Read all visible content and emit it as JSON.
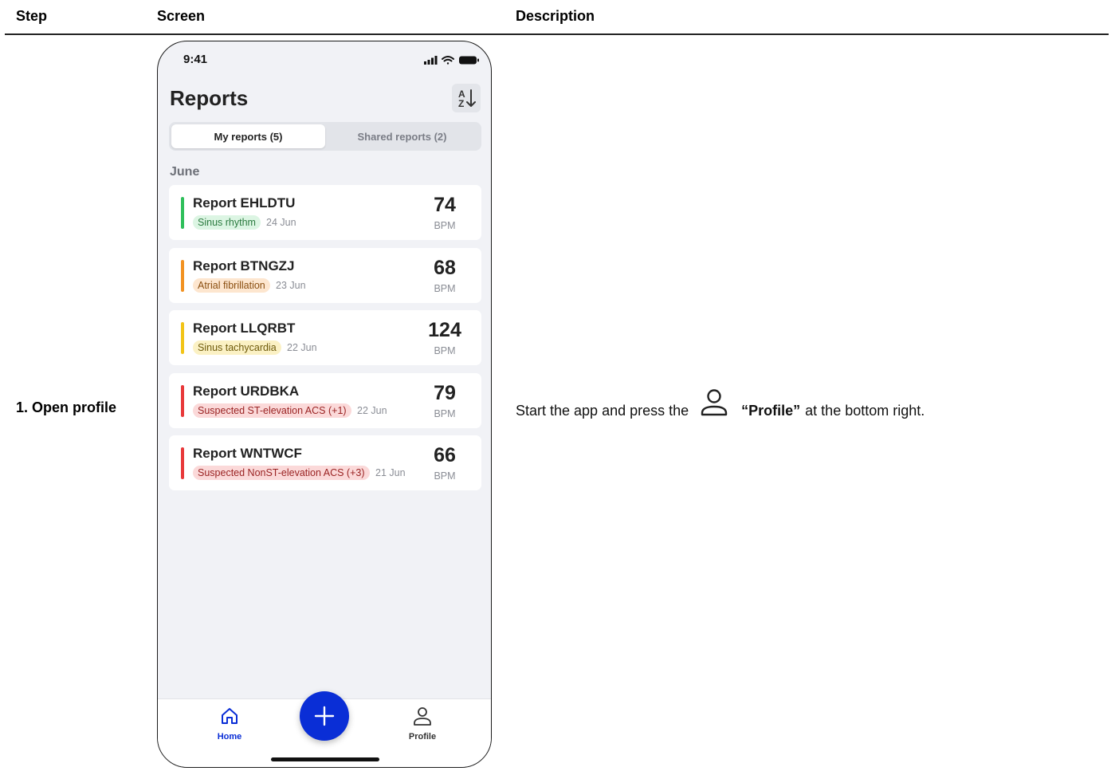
{
  "table": {
    "headers": {
      "step": "Step",
      "screen": "Screen",
      "description": "Description"
    },
    "step_label": "1. Open profile",
    "description": {
      "prefix": "Start the app and press the",
      "icon": "person-icon",
      "bold": "“Profile”",
      "suffix": "at the bottom right."
    }
  },
  "phone": {
    "status": {
      "time": "9:41",
      "icons": [
        "signal-icon",
        "wifi-icon",
        "battery-icon"
      ]
    },
    "title": "Reports",
    "sort_icon": "sort-az-icon",
    "tabs": {
      "my": "My reports (5)",
      "shared": "Shared reports (2)"
    },
    "month": "June",
    "reports": [
      {
        "name": "Report EHLDTU",
        "tag": "Sinus rhythm",
        "date": "24 Jun",
        "bpm": "74",
        "unit": "BPM",
        "color": "#2fbf5b",
        "tag_bg": "#dcf5e3",
        "tag_fg": "#2b7a3f"
      },
      {
        "name": "Report BTNGZJ",
        "tag": "Atrial fibrillation",
        "date": "23 Jun",
        "bpm": "68",
        "unit": "BPM",
        "color": "#f29222",
        "tag_bg": "#fde6cf",
        "tag_fg": "#8a4e10"
      },
      {
        "name": "Report LLQRBT",
        "tag": "Sinus tachycardia",
        "date": "22 Jun",
        "bpm": "124",
        "unit": "BPM",
        "color": "#f2c418",
        "tag_bg": "#fbf1c4",
        "tag_fg": "#6e5a0a"
      },
      {
        "name": "Report URDBKA",
        "tag": "Suspected ST-elevation ACS (+1)",
        "date": "22 Jun",
        "bpm": "79",
        "unit": "BPM",
        "color": "#e8393a",
        "tag_bg": "#fbd9d9",
        "tag_fg": "#9a2323"
      },
      {
        "name": "Report WNTWCF",
        "tag": "Suspected NonST-elevation ACS (+3)",
        "date": "21 Jun",
        "bpm": "66",
        "unit": "BPM",
        "color": "#e8393a",
        "tag_bg": "#fbd9d9",
        "tag_fg": "#9a2323"
      }
    ],
    "tabbar": {
      "home": {
        "label": "Home",
        "icon": "home-icon",
        "color": "#0a2ed6"
      },
      "add": {
        "icon": "plus-icon"
      },
      "profile": {
        "label": "Profile",
        "icon": "person-icon"
      }
    }
  }
}
